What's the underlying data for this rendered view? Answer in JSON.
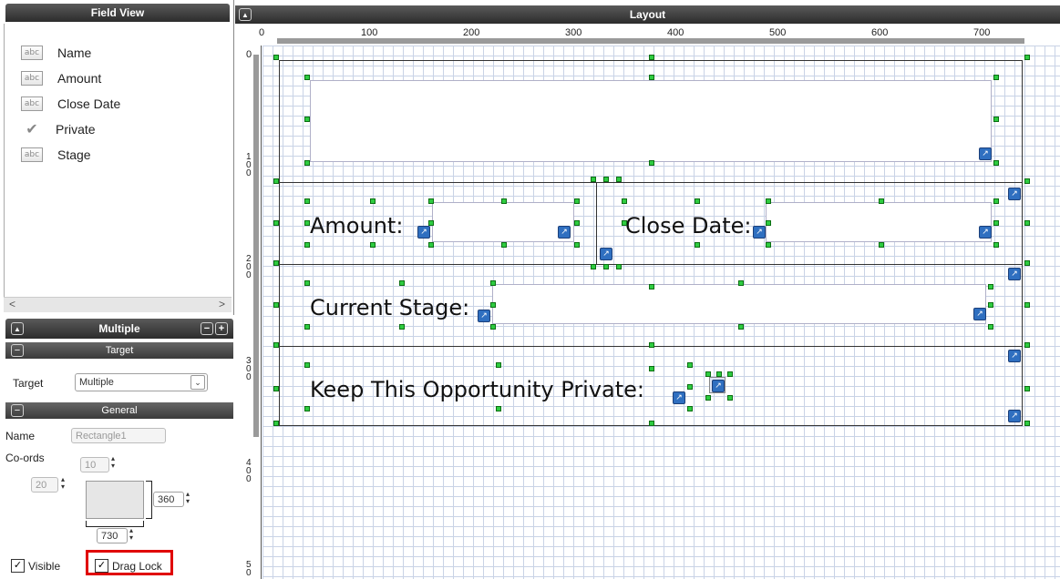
{
  "field_view": {
    "title": "Field View",
    "items": [
      {
        "label": "Name",
        "icon": "abc"
      },
      {
        "label": "Amount",
        "icon": "abc"
      },
      {
        "label": "Close Date",
        "icon": "abc"
      },
      {
        "label": "Private",
        "icon": "checkmark"
      },
      {
        "label": "Stage",
        "icon": "abc"
      }
    ],
    "abc_text": "abc",
    "scroll_left": "<",
    "scroll_right": ">"
  },
  "properties": {
    "title": "Multiple",
    "collapse_glyph": "▲",
    "minus": "−",
    "plus": "+",
    "target_section": "Target",
    "target_label": "Target",
    "target_value": "Multiple",
    "general_section": "General",
    "name_label": "Name",
    "name_value": "Rectangle1",
    "coords_label": "Co-ords",
    "top_value": "10",
    "left_value": "20",
    "height_value": "360",
    "width_value": "730",
    "visible_label": "Visible",
    "visible_checked": true,
    "drag_lock_label": "Drag Lock",
    "drag_lock_checked": true,
    "highlight_color": "#e00000"
  },
  "layout": {
    "title": "Layout",
    "collapse_glyph": "▲",
    "ruler_h": [
      "0",
      "100",
      "200",
      "300",
      "400",
      "500",
      "600",
      "700"
    ],
    "ruler_v": [
      "0",
      "1 0 0",
      "2 0 0",
      "3 0 0",
      "4 0 0",
      "5 0"
    ],
    "labels": {
      "amount": "Amount:",
      "close_date": "Close Date:",
      "current_stage": "Current Stage:",
      "keep_private": "Keep This Opportunity Private:"
    }
  },
  "colors": {
    "grid": "#c9d3e6",
    "handle": "#2ecc40",
    "pin": "#2f6fc0",
    "header_dark": "#2c2c2c"
  }
}
